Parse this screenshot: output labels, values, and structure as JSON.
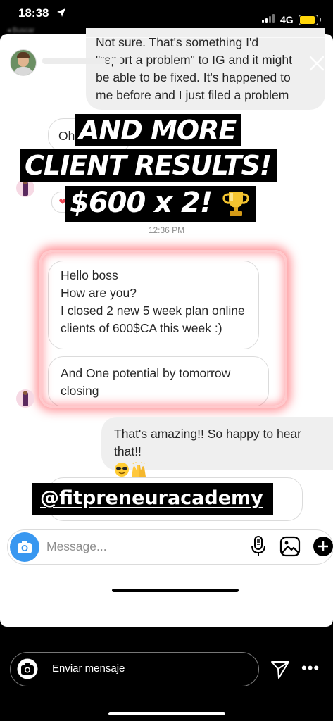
{
  "status_bar": {
    "time": "18:38",
    "network": "4G",
    "back_label": "◂ Buscar",
    "signal_level": 0.5,
    "battery_level": 0.85
  },
  "chat": {
    "incoming_reply_lines": [
      "Not sure. That's something I'd",
      "\"report a problem\" to IG and it might",
      "be able to be fixed. It's happened to",
      "me before and I just filed a problem"
    ],
    "partial_bubble_text": "Oh",
    "timestamp": "12:36 PM",
    "client_message_lines": [
      "Hello boss",
      "How are you?",
      "I closed 2 new 5 week plan online",
      "clients of 600$CA  this week :)"
    ],
    "client_followup_lines": [
      "And One potential by tomorrow",
      "closing"
    ],
    "reply_lines": [
      "That's amazing!! So happy to hear",
      "that!!"
    ],
    "reply_emojis": [
      "smiling-face-with-sunglasses",
      "raising-hands"
    ]
  },
  "composer": {
    "placeholder": "Message..."
  },
  "overlay": {
    "line1": "AND MORE",
    "line2": "CLIENT RESULTS!",
    "line3": "$600 x 2!",
    "line3_emoji": "trophy",
    "handle": "@fitpreneuracademy",
    "highlight_color": "#ff3c46"
  },
  "story_footer": {
    "send_message_placeholder": "Enviar mensaje",
    "more_label": "•••"
  },
  "colors": {
    "accent_blue": "#3897f0",
    "bubble_grey": "#efefef",
    "battery_yellow": "#ffd60a"
  }
}
